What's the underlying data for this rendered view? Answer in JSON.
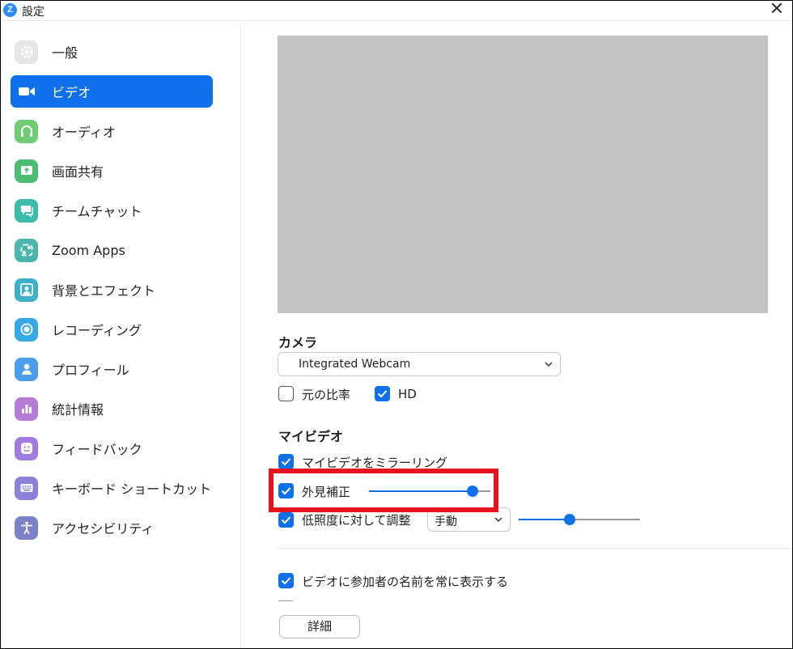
{
  "window": {
    "title": "設定",
    "app_icon_letter": "Z",
    "close_glyph": "✕"
  },
  "sidebar": {
    "items": [
      {
        "label": "一般",
        "icon": "gear-icon",
        "color": "#E6E6E6",
        "active": false
      },
      {
        "label": "ビデオ",
        "icon": "video-camera-icon",
        "color": "#0E71EB",
        "active": true
      },
      {
        "label": "オーディオ",
        "icon": "headphones-icon",
        "color": "#6FCB74",
        "active": false
      },
      {
        "label": "画面共有",
        "icon": "share-screen-icon",
        "color": "#4DBD74",
        "active": false
      },
      {
        "label": "チームチャット",
        "icon": "chat-icon",
        "color": "#3DBBAA",
        "active": false
      },
      {
        "label": "Zoom Apps",
        "icon": "apps-icon",
        "color": "#4DB6AC",
        "active": false
      },
      {
        "label": "背景とエフェクト",
        "icon": "background-icon",
        "color": "#3DB1C8",
        "active": false
      },
      {
        "label": "レコーディング",
        "icon": "record-icon",
        "color": "#38A9E6",
        "active": false
      },
      {
        "label": "プロフィール",
        "icon": "profile-icon",
        "color": "#4A9EEB",
        "active": false
      },
      {
        "label": "統計情報",
        "icon": "statistics-icon",
        "color": "#B57BD6",
        "active": false
      },
      {
        "label": "フィードバック",
        "icon": "feedback-icon",
        "color": "#A07BE0",
        "active": false
      },
      {
        "label": "キーボード ショートカット",
        "icon": "keyboard-icon",
        "color": "#8A82D6",
        "active": false
      },
      {
        "label": "アクセシビリティ",
        "icon": "accessibility-icon",
        "color": "#7C82C8",
        "active": false
      }
    ]
  },
  "camera": {
    "title": "カメラ",
    "selected": "Integrated Webcam",
    "original_ratio_label": "元の比率",
    "original_ratio_checked": false,
    "hd_label": "HD",
    "hd_checked": true
  },
  "my_video": {
    "title": "マイビデオ",
    "mirror_label": "マイビデオをミラーリング",
    "mirror_checked": true,
    "touch_up_label": "外見補正",
    "touch_up_checked": true,
    "touch_up_level_percent": 85,
    "low_light_label": "低照度に対して調整",
    "low_light_checked": true,
    "low_light_mode": "手動",
    "low_light_level_percent": 42
  },
  "display_names": {
    "label": "ビデオに参加者の名前を常に表示する",
    "checked": true
  },
  "advanced_button": "詳細",
  "colors": {
    "accent": "#0E71EB",
    "highlight": "#E5141E",
    "preview": "#C3C3C3"
  }
}
